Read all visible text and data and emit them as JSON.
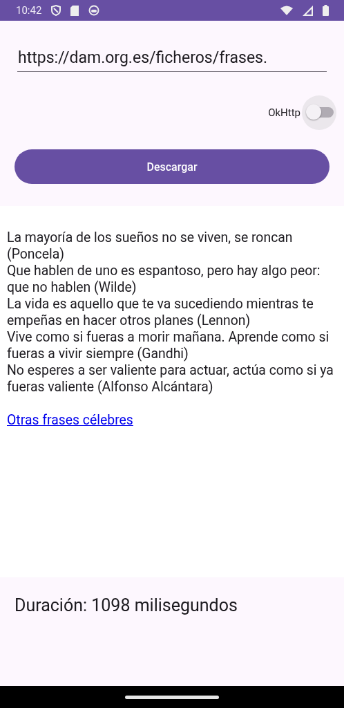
{
  "status_bar": {
    "time": "10:42"
  },
  "url_field": {
    "value": "https://dam.org.es/ficheros/frases."
  },
  "okhttp_switch": {
    "label": "OkHttp",
    "checked": false
  },
  "download_button": {
    "label": "Descargar"
  },
  "quotes": [
    "La mayoría de los sueños no se viven, se roncan (Poncela)",
    "Que hablen de uno es espantoso, pero hay algo peor: que no hablen (Wilde)",
    "La vida es aquello que te va sucediendo mientras te empeñas en hacer otros planes (Lennon)",
    "Vive como si fueras a morir mañana. Aprende como si fueras a vivir siempre (Gandhi)",
    "No esperes a ser valiente para actuar, actúa como si ya fueras valiente (Alfonso Alcántara)"
  ],
  "link": "Otras frases célebres",
  "duration": "Duración: 1098 milisegundos"
}
